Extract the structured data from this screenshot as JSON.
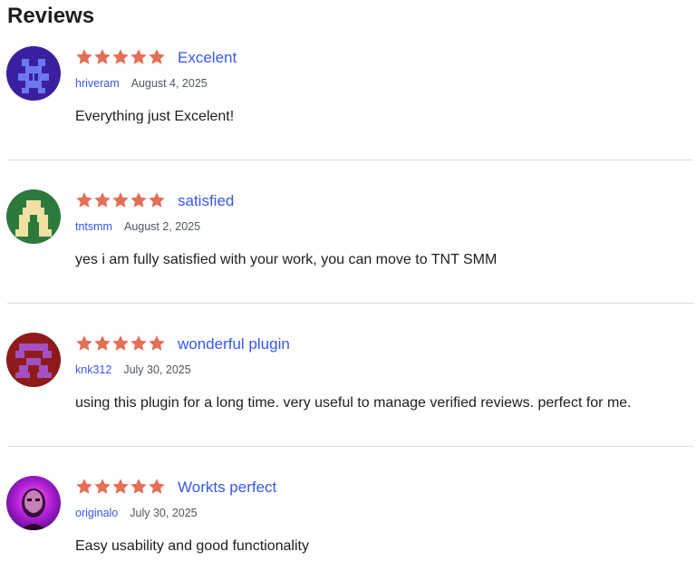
{
  "section": {
    "title": "Reviews"
  },
  "colors": {
    "star": "#e26f56",
    "link": "#3858e9",
    "divider": "#dcdcde"
  },
  "reviews": [
    {
      "rating": 5,
      "max_rating": 5,
      "title": "Excelent",
      "author": "hriveram",
      "date": "August 4, 2025",
      "text": "Everything just Excelent!",
      "avatar_icon": "purple-pixel-identicon"
    },
    {
      "rating": 5,
      "max_rating": 5,
      "title": "satisfied",
      "author": "tntsmm",
      "date": "August 2, 2025",
      "text": "yes i am fully satisfied with your work, you can move to TNT SMM",
      "avatar_icon": "green-pixel-identicon"
    },
    {
      "rating": 5,
      "max_rating": 5,
      "title": "wonderful plugin",
      "author": "knk312",
      "date": "July 30, 2025",
      "text": "using this plugin for a long time. very useful to manage verified reviews. perfect for me.",
      "avatar_icon": "red-pixel-identicon"
    },
    {
      "rating": 5,
      "max_rating": 5,
      "title": "Workts perfect",
      "author": "originalo",
      "date": "July 30, 2025",
      "text": "Easy usability and good functionality",
      "avatar_icon": "photo-avatar"
    }
  ]
}
